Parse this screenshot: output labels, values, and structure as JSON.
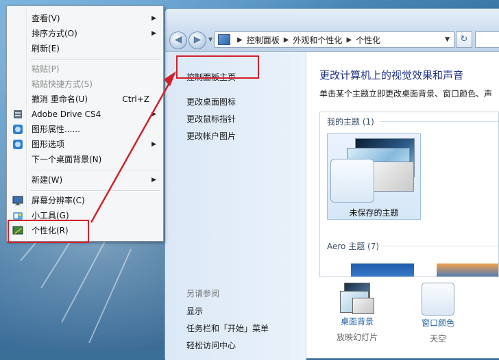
{
  "context_menu": {
    "items": [
      {
        "label": "查看(V)",
        "submenu": true,
        "disabled": false,
        "icon": ""
      },
      {
        "label": "排序方式(O)",
        "submenu": true,
        "disabled": false,
        "icon": ""
      },
      {
        "label": "刷新(E)",
        "submenu": false,
        "disabled": false,
        "icon": ""
      },
      {
        "label": "粘贴(P)",
        "submenu": false,
        "disabled": true,
        "icon": ""
      },
      {
        "label": "粘贴快捷方式(S)",
        "submenu": false,
        "disabled": true,
        "icon": ""
      },
      {
        "label": "撤消 重命名(U)",
        "shortcut": "Ctrl+Z",
        "submenu": false,
        "disabled": false,
        "icon": ""
      },
      {
        "label": "Adobe Drive CS4",
        "submenu": true,
        "disabled": false,
        "icon": "adobe-drive-icon"
      },
      {
        "label": "图形属性......",
        "submenu": false,
        "disabled": false,
        "icon": "graphics-properties-icon"
      },
      {
        "label": "图形选项",
        "submenu": true,
        "disabled": false,
        "icon": "graphics-options-icon"
      },
      {
        "label": "下一个桌面背景(N)",
        "submenu": false,
        "disabled": false,
        "icon": ""
      },
      {
        "label": "新建(W)",
        "submenu": true,
        "disabled": false,
        "icon": ""
      },
      {
        "label": "屏幕分辨率(C)",
        "submenu": false,
        "disabled": false,
        "icon": "screen-resolution-icon"
      },
      {
        "label": "小工具(G)",
        "submenu": false,
        "disabled": false,
        "icon": "gadgets-icon"
      },
      {
        "label": "个性化(R)",
        "submenu": false,
        "disabled": false,
        "icon": "personalize-icon"
      }
    ]
  },
  "window": {
    "address": {
      "segments": [
        "控制面板",
        "外观和个性化",
        "个性化"
      ]
    },
    "left_pane": {
      "home_link": "控制面板主页",
      "links": [
        "更改桌面图标",
        "更改鼠标指针",
        "更改帐户图片"
      ],
      "see_also_label": "另请参阅",
      "see_also": [
        "显示",
        "任务栏和「开始」菜单",
        "轻松访问中心"
      ]
    },
    "main": {
      "title": "更改计算机上的视觉效果和声音",
      "subtitle": "单击某个主题立即更改桌面背景、窗口颜色、声",
      "my_themes_label": "我的主题 (1)",
      "unsaved_theme": "未保存的主题",
      "aero_label": "Aero 主题 (7)"
    },
    "bottom": [
      {
        "label": "桌面背景",
        "sub": "放映幻灯片"
      },
      {
        "label": "窗口颜色",
        "sub": "天空"
      }
    ]
  },
  "annotation_color": "#d2202a"
}
